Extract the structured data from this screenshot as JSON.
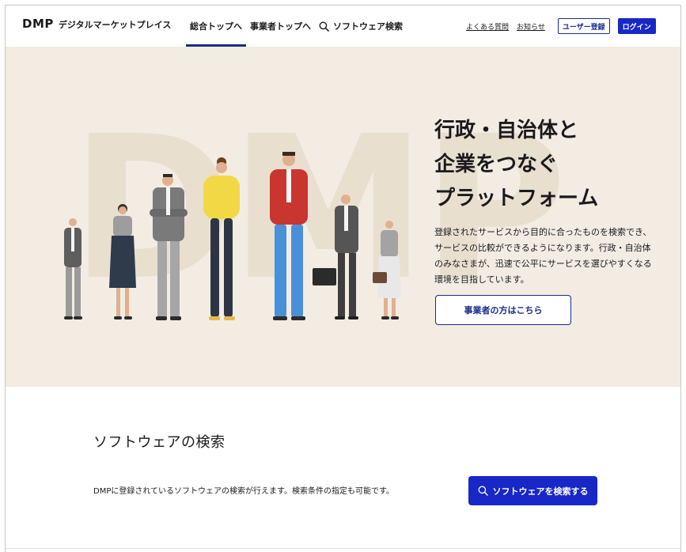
{
  "header": {
    "logo_mark": "DMP",
    "logo_text": "デジタルマーケットプレイス",
    "nav": [
      {
        "label": "総合トップへ",
        "active": true
      },
      {
        "label": "事業者トップへ",
        "active": false
      },
      {
        "label": "ソフトウェア検索",
        "active": false
      }
    ],
    "faq_link": "よくある質問",
    "news_link": "お知らせ",
    "register_button": "ユーザー登録",
    "login_button": "ログイン"
  },
  "hero": {
    "watermark": "DMP",
    "title_lines": [
      "行政・自治体と",
      "企業をつなぐ",
      "プラットフォーム"
    ],
    "description_lines": [
      "登録されたサービスから目的に合ったものを検索でき、",
      "サービスの比較ができるようになります。行政・自治体",
      "のみなさまが、迅速で公平にサービスを選びやすくなる",
      "環境を目指しています。"
    ],
    "cta_button": "事業者の方はこちら"
  },
  "software_search": {
    "title": "ソフトウェアの検索",
    "description": "DMPに登録されているソフトウェアの検索が行えます。検索条件の指定も可能です。",
    "button": "ソフトウェアを検索する"
  },
  "colors": {
    "brand_blue": "#1827c6",
    "navy": "#1a2b8c",
    "hero_bg": "#f2ece3"
  }
}
